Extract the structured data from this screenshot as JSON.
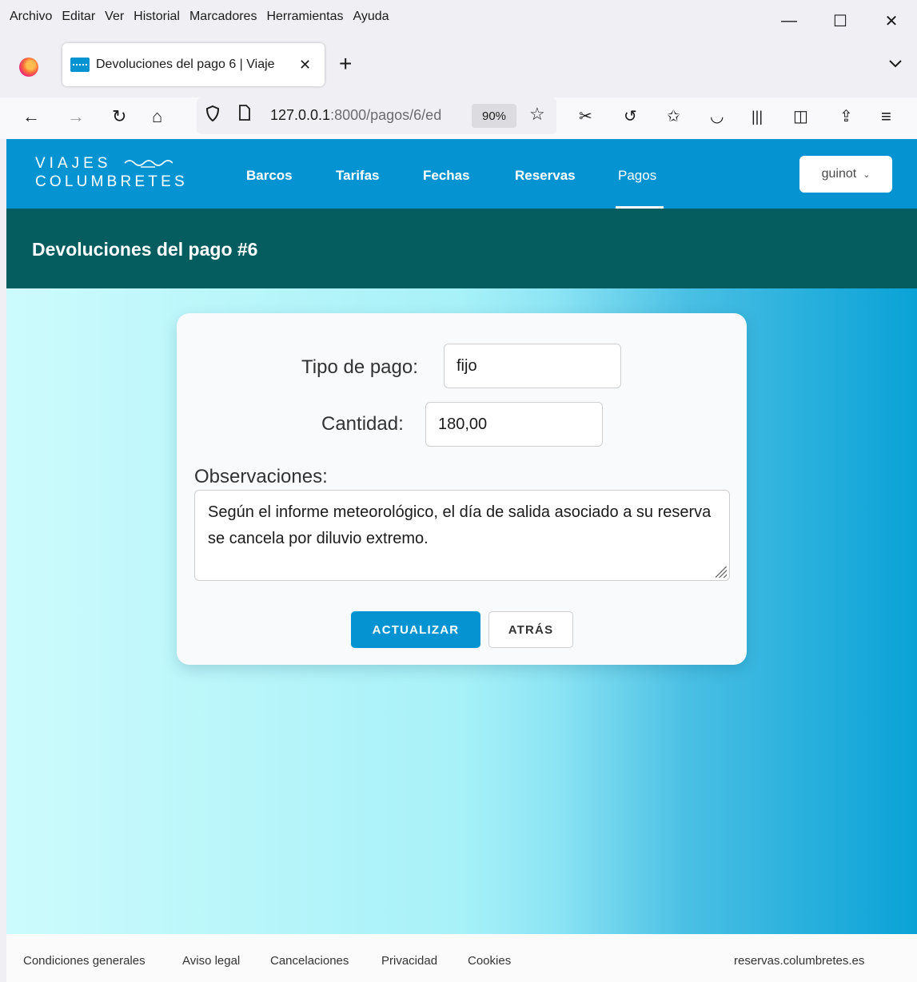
{
  "browser": {
    "menu": [
      "Archivo",
      "Editar",
      "Ver",
      "Historial",
      "Marcadores",
      "Herramientas",
      "Ayuda"
    ],
    "window_controls": {
      "minimize": "—",
      "maximize": "☐",
      "close": "✕"
    },
    "tab": {
      "title": "Devoluciones del pago 6 | Viaje",
      "close": "✕"
    },
    "new_tab": "+",
    "tab_list": "⌄",
    "url": {
      "host": "127.0.0.1",
      "rest": ":8000/pagos/6/ed"
    },
    "zoom": "90%"
  },
  "site": {
    "logo": {
      "line1": "VIAJES",
      "line2": "COLUMBRETES"
    },
    "nav": [
      "Barcos",
      "Tarifas",
      "Fechas",
      "Reservas",
      "Pagos"
    ],
    "active_nav": "Pagos",
    "user": "guinot"
  },
  "page": {
    "title": "Devoluciones del pago #6"
  },
  "form": {
    "tipo_label": "Tipo de pago:",
    "tipo_value": "fijo",
    "cantidad_label": "Cantidad:",
    "cantidad_value": "180,00",
    "observaciones_label": "Observaciones:",
    "observaciones_value": "Según el informe meteorológico, el día de salida asociado a su reserva se cancela por diluvio extremo.",
    "update_button": "ACTUALIZAR",
    "back_button": "ATRÁS"
  },
  "footer": {
    "links": [
      "Condiciones generales",
      "Aviso legal",
      "Cancelaciones",
      "Privacidad",
      "Cookies"
    ],
    "site": "reservas.columbretes.es"
  },
  "colors": {
    "brand": "#0594d1",
    "title_band": "#055d5f"
  }
}
